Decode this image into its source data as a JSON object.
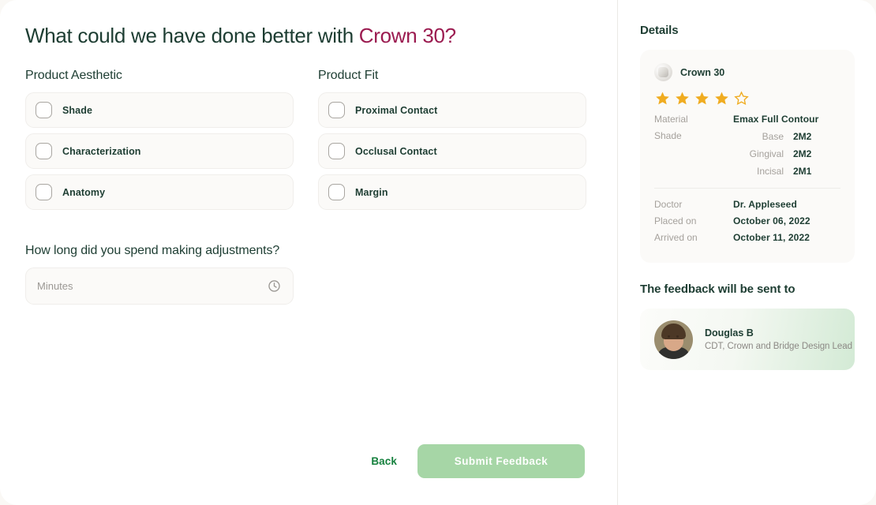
{
  "headline": {
    "prefix": "What could we have done better with ",
    "product": "Crown 30?"
  },
  "groups": [
    {
      "label": "Product Aesthetic",
      "options": [
        "Shade",
        "Characterization",
        "Anatomy"
      ]
    },
    {
      "label": "Product Fit",
      "options": [
        "Proximal Contact",
        "Occlusal Contact",
        "Margin"
      ]
    }
  ],
  "duration": {
    "question": "How long did you spend making adjustments?",
    "placeholder": "Minutes",
    "value": "",
    "icon": "clock-icon"
  },
  "footer": {
    "back_label": "Back",
    "submit_label": "Submit Feedback"
  },
  "details": {
    "title": "Details",
    "product_name": "Crown 30",
    "rating": 4,
    "rating_max": 5,
    "material_key": "Material",
    "material_value": "Emax Full Contour",
    "shade_key": "Shade",
    "shade_rows": [
      {
        "key": "Base",
        "value": "2M2"
      },
      {
        "key": "Gingival",
        "value": "2M2"
      },
      {
        "key": "Incisal",
        "value": "2M1"
      }
    ],
    "meta_rows": [
      {
        "key": "Doctor",
        "value": "Dr. Appleseed"
      },
      {
        "key": "Placed on",
        "value": "October 06, 2022"
      },
      {
        "key": "Arrived on",
        "value": "October 11, 2022"
      }
    ]
  },
  "recipient": {
    "title": "The feedback will be sent to",
    "name": "Douglas B",
    "role": "CDT, Crown and Bridge Design Lead"
  },
  "colors": {
    "heading_green": "#1d3d32",
    "product_magenta": "#9b1b50",
    "star_gold": "#f0ac20",
    "submit_green": "#a6d6a6",
    "back_green": "#15803d"
  }
}
